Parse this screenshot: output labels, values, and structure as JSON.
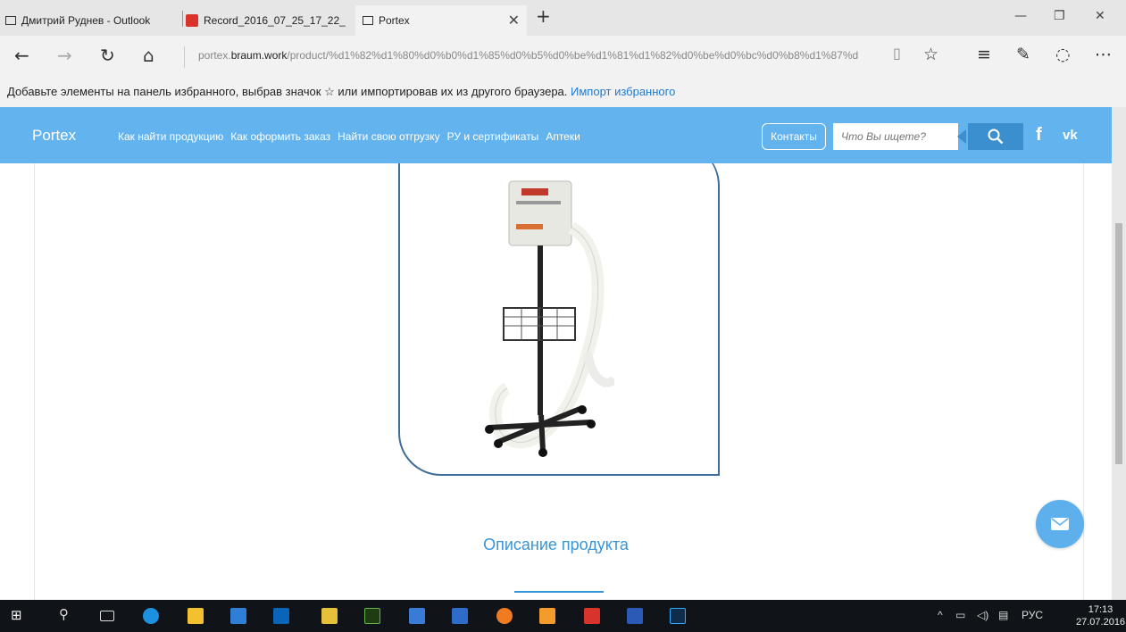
{
  "browser": {
    "tabs": [
      {
        "label": "Дмитрий Руднев - Outlook"
      },
      {
        "label": "Record_2016_07_25_17_22_"
      },
      {
        "label": "Portex"
      }
    ],
    "url_host_prefix": "portex.",
    "url_host_main": "braum.work",
    "url_path": "/product/%d1%82%d1%80%d0%b0%d1%85%d0%b5%d0%be%d1%81%d1%82%d0%be%d0%bc%d0%b8%d1%87%d",
    "favorites_text": "Добавьте элементы на панель избранного, выбрав значок ☆ или импортировав их из другого браузера. ",
    "favorites_link": "Импорт избранного"
  },
  "site": {
    "brand": "Portex",
    "menu": [
      "Как найти продукцию",
      "Как оформить заказ",
      "Найти свою отгрузку",
      "РУ и сертификаты",
      "Аптеки"
    ],
    "contacts_label": "Контакты",
    "search_placeholder": "Что Вы ищете?",
    "social": {
      "facebook": "f",
      "vk": "vk"
    },
    "description_title": "Описание продукта"
  },
  "taskbar": {
    "lang": "РУС",
    "time": "17:13",
    "date": "27.07.2016"
  },
  "colors": {
    "header": "#63b3ee",
    "accent": "#3894d8",
    "frame": "#3f6c99",
    "taskbar": "#101419"
  }
}
